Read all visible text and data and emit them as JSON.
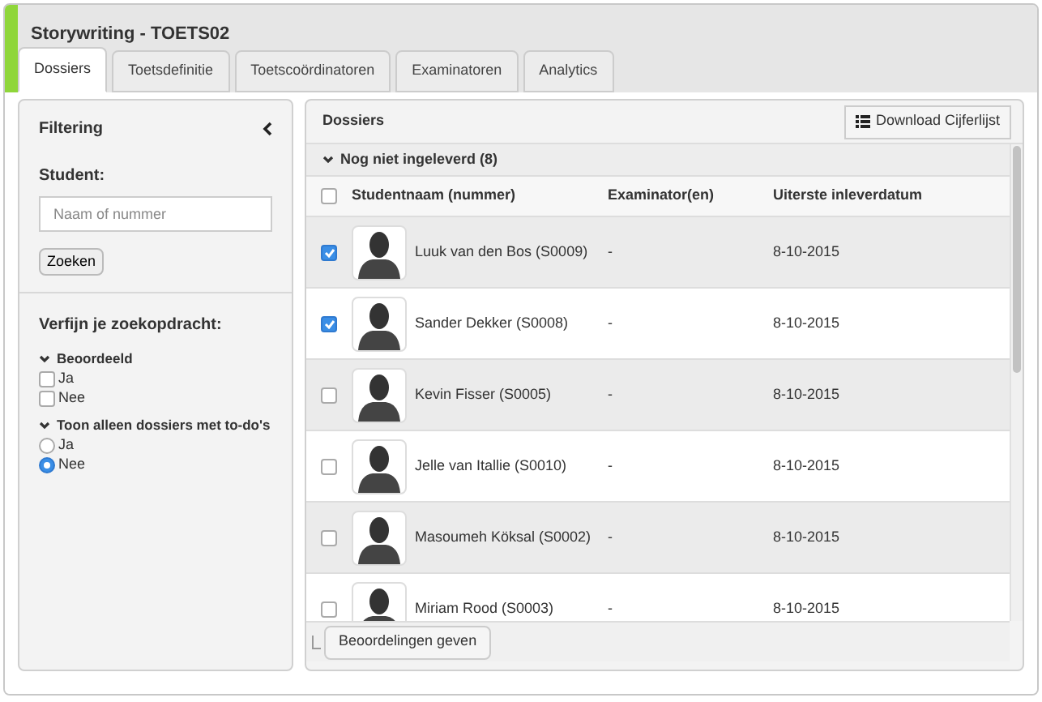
{
  "window": {
    "title": "Storywriting - TOETS02"
  },
  "tabs": [
    {
      "label": "Dossiers",
      "selected": true
    },
    {
      "label": "Toetsdefinitie",
      "selected": false
    },
    {
      "label": "Toetscoördinatoren",
      "selected": false
    },
    {
      "label": "Examinatoren",
      "selected": false
    },
    {
      "label": "Analytics",
      "selected": false
    }
  ],
  "filter": {
    "title": "Filtering",
    "student_label": "Student:",
    "search_field": {
      "placeholder": "Naam of nummer"
    },
    "search_button": "Zoeken",
    "refine_label": "Verfijn je zoekopdracht:",
    "groups": [
      {
        "title": "Beoordeeld",
        "kind": "checkbox",
        "options": [
          {
            "label": "Ja",
            "checked": false
          },
          {
            "label": "Nee",
            "checked": false
          }
        ]
      },
      {
        "title": "Toon alleen dossiers met to-do's",
        "kind": "radio",
        "options": [
          {
            "label": "Ja",
            "checked": false
          },
          {
            "label": "Nee",
            "checked": true
          }
        ]
      }
    ]
  },
  "dossiers": {
    "title": "Dossiers",
    "download_button": "Download Cijferlijst",
    "group": "Nog niet ingeleverd (8)",
    "select_all_checked": false,
    "columns": [
      "Studentnaam (nummer)",
      "Examinator(en)",
      "Uiterste inleverdatum"
    ],
    "rows": [
      {
        "name": "Luuk van den Bos (S0009)",
        "examiner": "-",
        "deadline": "8-10-2015",
        "checked": true
      },
      {
        "name": "Sander Dekker (S0008)",
        "examiner": "-",
        "deadline": "8-10-2015",
        "checked": true
      },
      {
        "name": "Kevin Fisser (S0005)",
        "examiner": "-",
        "deadline": "8-10-2015",
        "checked": false
      },
      {
        "name": "Jelle van Itallie (S0010)",
        "examiner": "-",
        "deadline": "8-10-2015",
        "checked": false
      },
      {
        "name": "Masoumeh Köksal (S0002)",
        "examiner": "-",
        "deadline": "8-10-2015",
        "checked": false
      },
      {
        "name": "Miriam Rood (S0003)",
        "examiner": "-",
        "deadline": "8-10-2015",
        "checked": false
      }
    ],
    "footer_button": "Beoordelingen geven"
  }
}
